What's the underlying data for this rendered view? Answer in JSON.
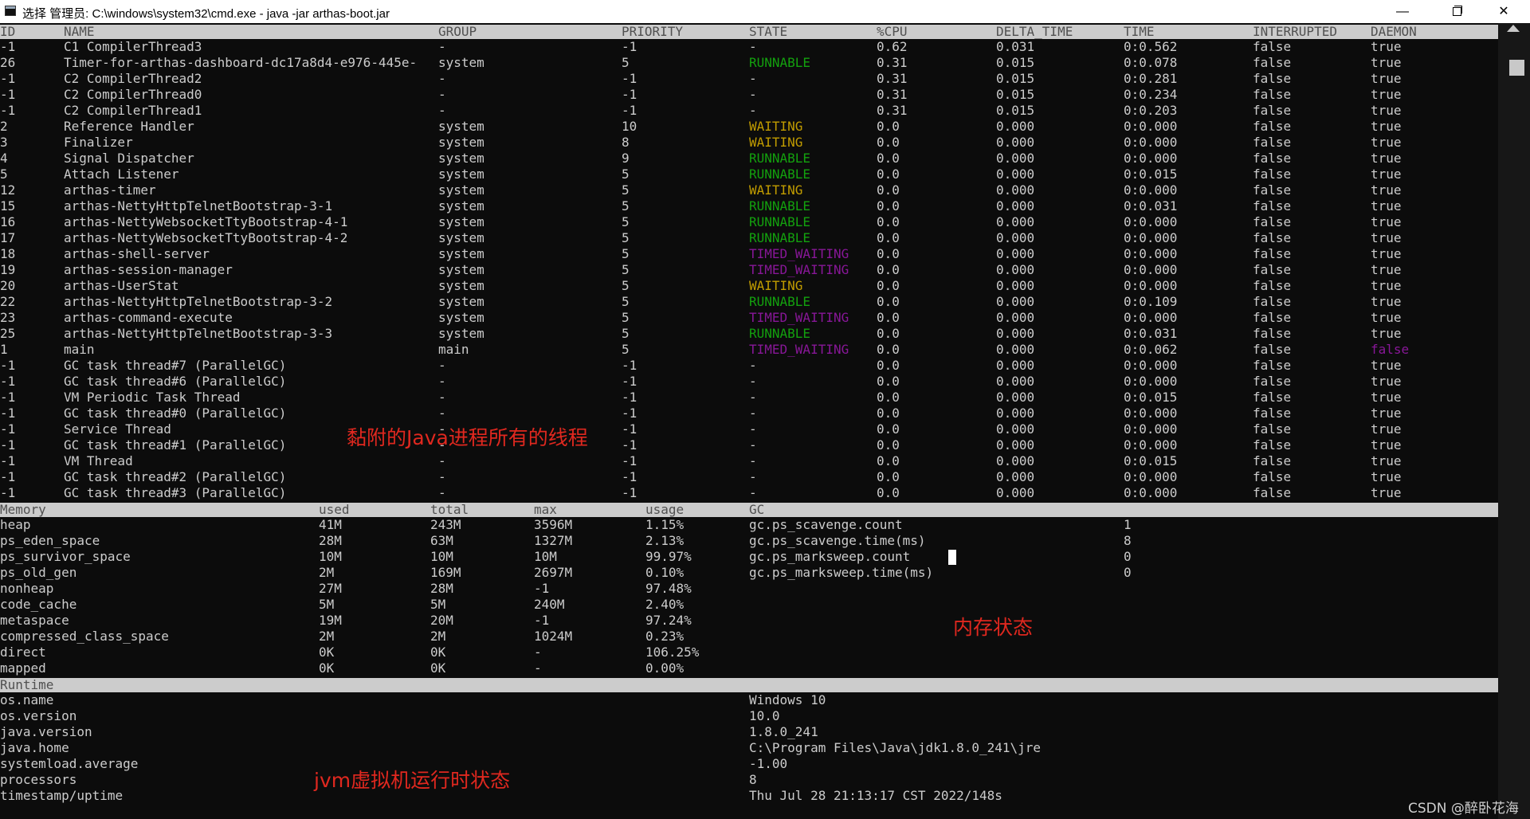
{
  "window": {
    "title": "选择 管理员: C:\\windows\\system32\\cmd.exe - java  -jar arthas-boot.jar",
    "min_glyph": "—",
    "close_glyph": "✕"
  },
  "threads": {
    "columns": [
      "ID",
      "NAME",
      "GROUP",
      "PRIORITY",
      "STATE",
      "%CPU",
      "DELTA_TIME",
      "TIME",
      "INTERRUPTED",
      "DAEMON"
    ],
    "rows": [
      [
        "-1",
        "C1 CompilerThread3",
        "-",
        "-1",
        "-",
        "0.62",
        "0.031",
        "0:0.562",
        "false",
        "true"
      ],
      [
        "26",
        "Timer-for-arthas-dashboard-dc17a8d4-e976-445e-",
        "system",
        "5",
        "RUNNABLE",
        "0.31",
        "0.015",
        "0:0.078",
        "false",
        "true"
      ],
      [
        "-1",
        "C2 CompilerThread2",
        "-",
        "-1",
        "-",
        "0.31",
        "0.015",
        "0:0.281",
        "false",
        "true"
      ],
      [
        "-1",
        "C2 CompilerThread0",
        "-",
        "-1",
        "-",
        "0.31",
        "0.015",
        "0:0.234",
        "false",
        "true"
      ],
      [
        "-1",
        "C2 CompilerThread1",
        "-",
        "-1",
        "-",
        "0.31",
        "0.015",
        "0:0.203",
        "false",
        "true"
      ],
      [
        "2",
        "Reference Handler",
        "system",
        "10",
        "WAITING",
        "0.0",
        "0.000",
        "0:0.000",
        "false",
        "true"
      ],
      [
        "3",
        "Finalizer",
        "system",
        "8",
        "WAITING",
        "0.0",
        "0.000",
        "0:0.000",
        "false",
        "true"
      ],
      [
        "4",
        "Signal Dispatcher",
        "system",
        "9",
        "RUNNABLE",
        "0.0",
        "0.000",
        "0:0.000",
        "false",
        "true"
      ],
      [
        "5",
        "Attach Listener",
        "system",
        "5",
        "RUNNABLE",
        "0.0",
        "0.000",
        "0:0.015",
        "false",
        "true"
      ],
      [
        "12",
        "arthas-timer",
        "system",
        "5",
        "WAITING",
        "0.0",
        "0.000",
        "0:0.000",
        "false",
        "true"
      ],
      [
        "15",
        "arthas-NettyHttpTelnetBootstrap-3-1",
        "system",
        "5",
        "RUNNABLE",
        "0.0",
        "0.000",
        "0:0.031",
        "false",
        "true"
      ],
      [
        "16",
        "arthas-NettyWebsocketTtyBootstrap-4-1",
        "system",
        "5",
        "RUNNABLE",
        "0.0",
        "0.000",
        "0:0.000",
        "false",
        "true"
      ],
      [
        "17",
        "arthas-NettyWebsocketTtyBootstrap-4-2",
        "system",
        "5",
        "RUNNABLE",
        "0.0",
        "0.000",
        "0:0.000",
        "false",
        "true"
      ],
      [
        "18",
        "arthas-shell-server",
        "system",
        "5",
        "TIMED_WAITING",
        "0.0",
        "0.000",
        "0:0.000",
        "false",
        "true"
      ],
      [
        "19",
        "arthas-session-manager",
        "system",
        "5",
        "TIMED_WAITING",
        "0.0",
        "0.000",
        "0:0.000",
        "false",
        "true"
      ],
      [
        "20",
        "arthas-UserStat",
        "system",
        "5",
        "WAITING",
        "0.0",
        "0.000",
        "0:0.000",
        "false",
        "true"
      ],
      [
        "22",
        "arthas-NettyHttpTelnetBootstrap-3-2",
        "system",
        "5",
        "RUNNABLE",
        "0.0",
        "0.000",
        "0:0.109",
        "false",
        "true"
      ],
      [
        "23",
        "arthas-command-execute",
        "system",
        "5",
        "TIMED_WAITING",
        "0.0",
        "0.000",
        "0:0.000",
        "false",
        "true"
      ],
      [
        "25",
        "arthas-NettyHttpTelnetBootstrap-3-3",
        "system",
        "5",
        "RUNNABLE",
        "0.0",
        "0.000",
        "0:0.031",
        "false",
        "true"
      ],
      [
        "1",
        "main",
        "main",
        "5",
        "TIMED_WAITING",
        "0.0",
        "0.000",
        "0:0.062",
        "false",
        "false"
      ],
      [
        "-1",
        "GC task thread#7 (ParallelGC)",
        "-",
        "-1",
        "-",
        "0.0",
        "0.000",
        "0:0.000",
        "false",
        "true"
      ],
      [
        "-1",
        "GC task thread#6 (ParallelGC)",
        "-",
        "-1",
        "-",
        "0.0",
        "0.000",
        "0:0.000",
        "false",
        "true"
      ],
      [
        "-1",
        "VM Periodic Task Thread",
        "-",
        "-1",
        "-",
        "0.0",
        "0.000",
        "0:0.015",
        "false",
        "true"
      ],
      [
        "-1",
        "GC task thread#0 (ParallelGC)",
        "-",
        "-1",
        "-",
        "0.0",
        "0.000",
        "0:0.000",
        "false",
        "true"
      ],
      [
        "-1",
        "Service Thread",
        "-",
        "-1",
        "-",
        "0.0",
        "0.000",
        "0:0.000",
        "false",
        "true"
      ],
      [
        "-1",
        "GC task thread#1 (ParallelGC)",
        "-",
        "-1",
        "-",
        "0.0",
        "0.000",
        "0:0.000",
        "false",
        "true"
      ],
      [
        "-1",
        "VM Thread",
        "-",
        "-1",
        "-",
        "0.0",
        "0.000",
        "0:0.015",
        "false",
        "true"
      ],
      [
        "-1",
        "GC task thread#2 (ParallelGC)",
        "-",
        "-1",
        "-",
        "0.0",
        "0.000",
        "0:0.000",
        "false",
        "true"
      ],
      [
        "-1",
        "GC task thread#3 (ParallelGC)",
        "-",
        "-1",
        "-",
        "0.0",
        "0.000",
        "0:0.000",
        "false",
        "true"
      ]
    ]
  },
  "memory": {
    "columns": [
      "Memory",
      "used",
      "total",
      "max",
      "usage",
      "GC"
    ],
    "rows": [
      [
        "heap",
        "41M",
        "243M",
        "3596M",
        "1.15%"
      ],
      [
        "ps_eden_space",
        "28M",
        "63M",
        "1327M",
        "2.13%"
      ],
      [
        "ps_survivor_space",
        "10M",
        "10M",
        "10M",
        "99.97%"
      ],
      [
        "ps_old_gen",
        "2M",
        "169M",
        "2697M",
        "0.10%"
      ],
      [
        "nonheap",
        "27M",
        "28M",
        "-1",
        "97.48%"
      ],
      [
        "code_cache",
        "5M",
        "5M",
        "240M",
        "2.40%"
      ],
      [
        "metaspace",
        "19M",
        "20M",
        "-1",
        "97.24%"
      ],
      [
        "compressed_class_space",
        "2M",
        "2M",
        "1024M",
        "0.23%"
      ],
      [
        "direct",
        "0K",
        "0K",
        "-",
        "106.25%"
      ],
      [
        "mapped",
        "0K",
        "0K",
        "-",
        "0.00%"
      ]
    ],
    "gc": [
      [
        "gc.ps_scavenge.count",
        "1"
      ],
      [
        "gc.ps_scavenge.time(ms)",
        "8"
      ],
      [
        "gc.ps_marksweep.count",
        "0"
      ],
      [
        "gc.ps_marksweep.time(ms)",
        "0"
      ]
    ]
  },
  "runtime": {
    "header": "Runtime",
    "rows": [
      [
        "os.name",
        "Windows 10"
      ],
      [
        "os.version",
        "10.0"
      ],
      [
        "java.version",
        "1.8.0_241"
      ],
      [
        "java.home",
        "C:\\Program Files\\Java\\jdk1.8.0_241\\jre"
      ],
      [
        "systemload.average",
        "-1.00"
      ],
      [
        "processors",
        "8"
      ],
      [
        "timestamp/uptime",
        "Thu Jul 28 21:13:17 CST 2022/148s"
      ]
    ]
  },
  "annotations": {
    "threads_note": "黏附的Java进程所有的线程",
    "memory_note": "内存状态",
    "runtime_note": "jvm虚拟机运行时状态"
  },
  "watermark": "CSDN @醉卧花海",
  "colors": {
    "background": "#0c0c0c",
    "text": "#cccccc",
    "header_bar": "#cccccc",
    "runnable": "#13a10e",
    "waiting": "#c19c00",
    "timed_waiting": "#881798",
    "annotation": "#e0281f"
  }
}
